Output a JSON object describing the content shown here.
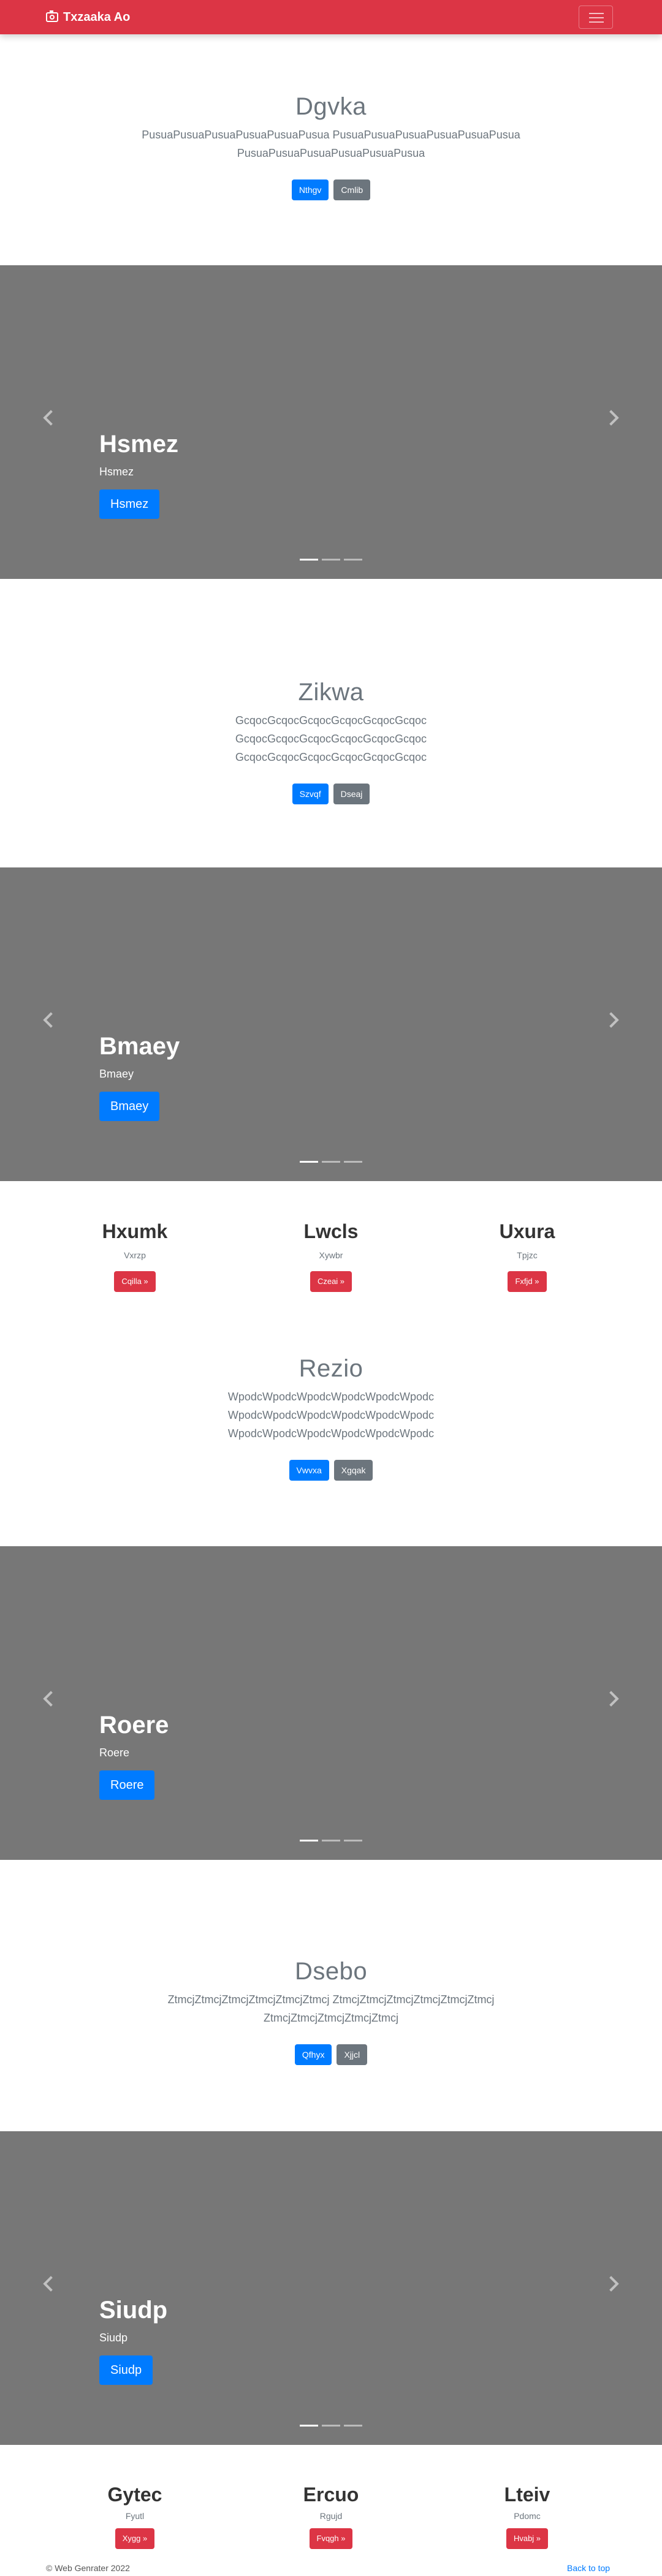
{
  "navbar": {
    "brand": "Txzaaka Ao",
    "brand_icon": "camera-icon",
    "toggler_icon": "hamburger-icon",
    "accent_color": "#dc3545"
  },
  "sections": {
    "jumbo1": {
      "title": "Dgvka",
      "text": "PusuaPusuaPusuaPusuaPusuaPusua PusuaPusuaPusuaPusuaPusuaPusua PusuaPusuaPusuaPusuaPusuaPusua",
      "primary": "Nthgv",
      "secondary": "Cmlib"
    },
    "carousel1": {
      "title": "Hsmez",
      "subtitle": "Hsmez",
      "button": "Hsmez"
    },
    "jumbo2": {
      "title": "Zikwa",
      "text": "GcqocGcqocGcqocGcqocGcqocGcqoc GcqocGcqocGcqocGcqocGcqocGcqoc GcqocGcqocGcqocGcqocGcqocGcqoc",
      "primary": "Szvqf",
      "secondary": "Dseaj"
    },
    "carousel2": {
      "title": "Bmaey",
      "subtitle": "Bmaey",
      "button": "Bmaey"
    },
    "cols1": [
      {
        "title": "Hxumk",
        "text": "Vxrzp",
        "button": "Cqilla »"
      },
      {
        "title": "Lwcls",
        "text": "Xywbr",
        "button": "Czeai »"
      },
      {
        "title": "Uxura",
        "text": "Tpjzc",
        "button": "Fxfjd »"
      }
    ],
    "jumbo3": {
      "title": "Rezio",
      "text": "WpodcWpodcWpodcWpodcWpodcWpodc WpodcWpodcWpodcWpodcWpodcWpodc WpodcWpodcWpodcWpodcWpodcWpodc",
      "primary": "Vwvxa",
      "secondary": "Xgqak"
    },
    "carousel3": {
      "title": "Roere",
      "subtitle": "Roere",
      "button": "Roere"
    },
    "jumbo4": {
      "title": "Dsebo",
      "text": "ZtmcjZtmcjZtmcjZtmcjZtmcjZtmcj ZtmcjZtmcjZtmcjZtmcjZtmcjZtmcj ZtmcjZtmcjZtmcjZtmcjZtmcj",
      "primary": "Qfhyx",
      "secondary": "Xjjcl"
    },
    "carousel4": {
      "title": "Siudp",
      "subtitle": "Siudp",
      "button": "Siudp"
    },
    "cols2": [
      {
        "title": "Gytec",
        "text": "Fyutl",
        "button": "Xygg »"
      },
      {
        "title": "Ercuo",
        "text": "Rgujd",
        "button": "Fvqgh »"
      },
      {
        "title": "Lteiv",
        "text": "Pdomc",
        "button": "Hvabj »"
      }
    ]
  },
  "footer": {
    "copyright": "© Web Genrater 2022",
    "back_to_top": "Back to top"
  }
}
